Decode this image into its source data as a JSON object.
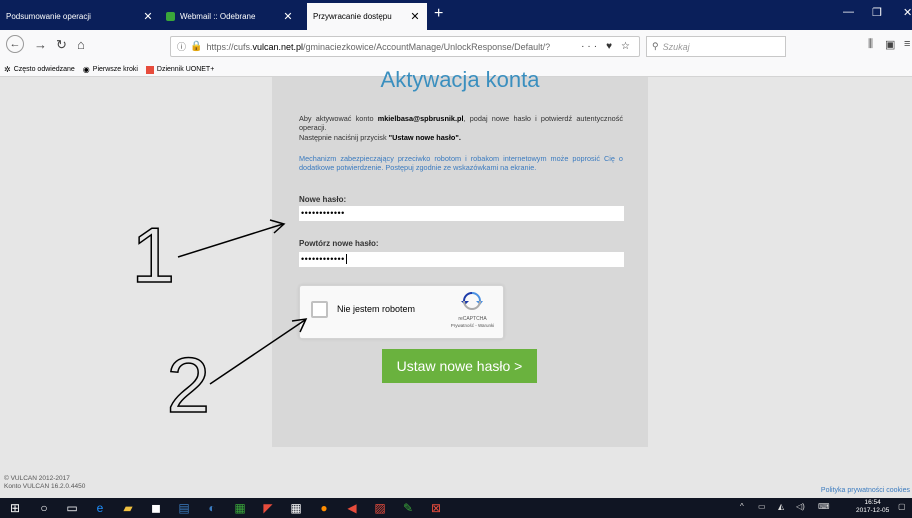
{
  "browser": {
    "tabs": [
      {
        "label": "Podsumowanie operacji",
        "active": false
      },
      {
        "label": "Webmail :: Odebrane",
        "active": false
      },
      {
        "label": "Przywracanie dostępu",
        "active": true
      }
    ],
    "url_prefix": "https://cufs.",
    "url_domain": "vulcan.net.pl",
    "url_path": "/gminaciezkowice/AccountManage/UnlockResponse/Default/?",
    "search_placeholder": "Szukaj",
    "bookmarks": [
      {
        "label": "Często odwiedzane",
        "icon": "gear-icon"
      },
      {
        "label": "Pierwsze kroki",
        "icon": "firefox-icon"
      },
      {
        "label": "Dziennik UONET+",
        "icon": "uonet-icon"
      }
    ]
  },
  "page": {
    "heading": "Aktywacja konta",
    "intro_1": "Aby aktywować konto ",
    "account": "mkielbasa@spbrusnik.pl",
    "intro_2": ", podaj nowe hasło i potwierdź autentyczność operacji.",
    "intro_3": "Następnie naciśnij przycisk ",
    "intro_button_ref": "\"Ustaw nowe hasło\".",
    "mechanism": "Mechanizm zabezpieczający przeciwko robotom i robakom internetowym może poprosić Cię o dodatkowe potwierdzenie. Postępuj zgodnie ze wskazówkami na ekranie.",
    "new_password_label": "Nowe hasło:",
    "new_password_value": "••••••••••••",
    "repeat_password_label": "Powtórz nowe hasło:",
    "repeat_password_value": "••••••••••••",
    "captcha_label": "Nie jestem robotem",
    "captcha_brand": "reCAPTCHA",
    "captcha_links": "Prywatność - Warunki",
    "submit_label": "Ustaw nowe hasło >",
    "footer_copyright": "© VULCAN 2012-2017",
    "footer_version": "Konto VULCAN 16.2.0.4450",
    "footer_privacy": "Polityka prywatności cookies"
  },
  "annotations": {
    "one": "1",
    "two": "2"
  },
  "taskbar": {
    "time": "16:54",
    "date": "2017-12-05"
  },
  "colors": {
    "accent_blue": "#3a8fbf",
    "submit_green": "#6ab23e",
    "tabbar": "#0a1f5a",
    "taskbar": "#101523"
  }
}
